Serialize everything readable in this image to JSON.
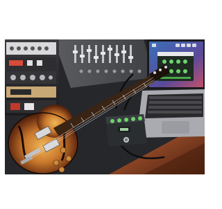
{
  "image": {
    "alt": "",
    "kind": "product-photo"
  },
  "colors": {
    "page_background": "#ffffff",
    "guitar_sunburst_center": "#e0a24a",
    "guitar_sunburst_edge": "#3a1a0b",
    "table_wood": "#7a3b1f",
    "laptop_screen_bg": "#3b4c8a",
    "pedal_body": "#2b2e31",
    "pedal_accent": "#6fd36a"
  }
}
